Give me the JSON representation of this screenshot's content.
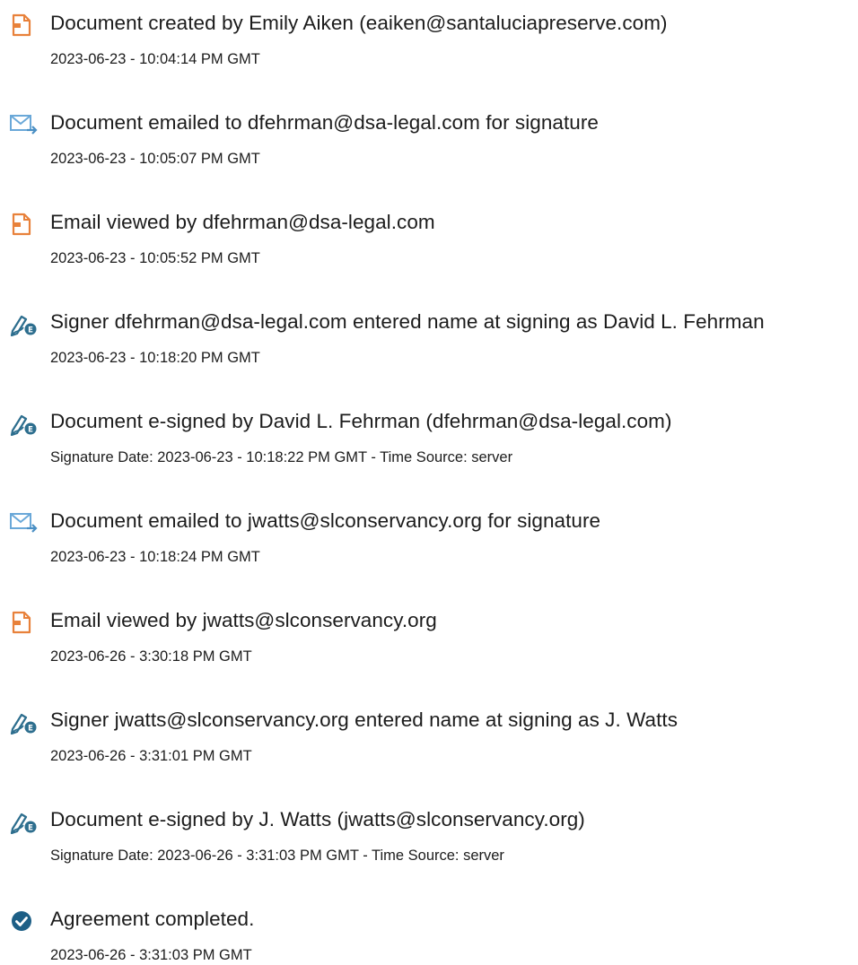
{
  "events": [
    {
      "icon": "document-icon",
      "title": "Document created by Emily Aiken (eaiken@santaluciapreserve.com)",
      "time": "2023-06-23 - 10:04:14 PM GMT"
    },
    {
      "icon": "email-sent-icon",
      "title": "Document emailed to dfehrman@dsa-legal.com for signature",
      "time": "2023-06-23 - 10:05:07 PM GMT"
    },
    {
      "icon": "document-icon",
      "title": "Email viewed by dfehrman@dsa-legal.com",
      "time": "2023-06-23 - 10:05:52 PM GMT"
    },
    {
      "icon": "e-sign-pen-icon",
      "title": "Signer dfehrman@dsa-legal.com entered name at signing as David L. Fehrman",
      "time": "2023-06-23 - 10:18:20 PM GMT"
    },
    {
      "icon": "e-sign-pen-icon",
      "title": "Document e-signed by David L. Fehrman (dfehrman@dsa-legal.com)",
      "time": "Signature Date: 2023-06-23 - 10:18:22 PM GMT - Time Source: server"
    },
    {
      "icon": "email-sent-icon",
      "title": "Document emailed to jwatts@slconservancy.org for signature",
      "time": "2023-06-23 - 10:18:24 PM GMT"
    },
    {
      "icon": "document-icon",
      "title": "Email viewed by jwatts@slconservancy.org",
      "time": "2023-06-26 - 3:30:18 PM GMT"
    },
    {
      "icon": "e-sign-pen-icon",
      "title": "Signer jwatts@slconservancy.org entered name at signing as J. Watts",
      "time": "2023-06-26 - 3:31:01 PM GMT"
    },
    {
      "icon": "e-sign-pen-icon",
      "title": "Document e-signed by J. Watts (jwatts@slconservancy.org)",
      "time": "Signature Date: 2023-06-26 - 3:31:03 PM GMT - Time Source: server"
    },
    {
      "icon": "check-circle-icon",
      "title": "Agreement completed.",
      "time": "2023-06-26 - 3:31:03 PM GMT"
    }
  ],
  "colors": {
    "document_icon": "#e8813a",
    "email_icon": "#6aa8d8",
    "esign_icon": "#2d6e8e",
    "check_icon": "#1d5f86",
    "text": "#1c1c1c"
  }
}
